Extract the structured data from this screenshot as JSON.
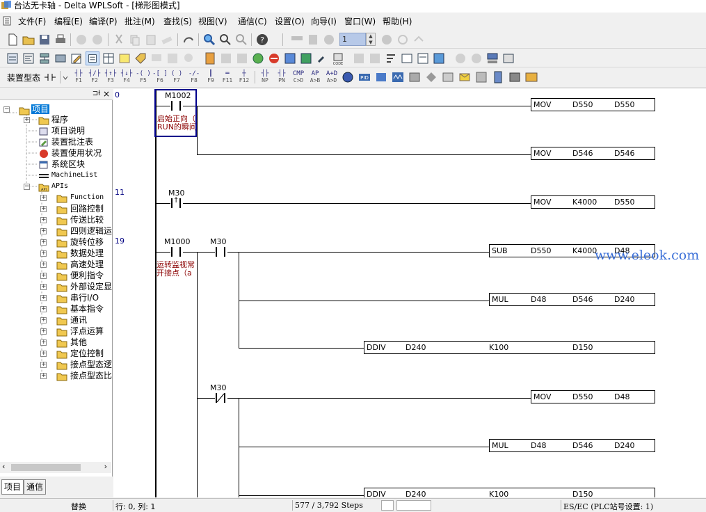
{
  "window": {
    "title": "台达无卡轴 - Delta WPLSoft - [梯形图模式]"
  },
  "menu": [
    "文件(F)",
    "编程(E)",
    "编译(P)",
    "批注(M)",
    "查找(S)",
    "视图(V)",
    "通信(C)",
    "设置(O)",
    "向导(I)",
    "窗口(W)",
    "帮助(H)"
  ],
  "toolbar": {
    "step_value": "1"
  },
  "devbar": {
    "label": "装置型态",
    "fkeys": [
      {
        "sym": "┤├",
        "lbl": "F1"
      },
      {
        "sym": "┤/├",
        "lbl": "F2"
      },
      {
        "sym": "┤↑├",
        "lbl": "F3"
      },
      {
        "sym": "┤↓├",
        "lbl": "F4"
      },
      {
        "sym": "-( )",
        "lbl": "F5"
      },
      {
        "sym": "-[ ]",
        "lbl": "F6"
      },
      {
        "sym": "( )",
        "lbl": "F7"
      },
      {
        "sym": "-/-",
        "lbl": "F8"
      },
      {
        "sym": "┃",
        "lbl": "F9"
      },
      {
        "sym": "═",
        "lbl": "F11"
      },
      {
        "sym": "┼",
        "lbl": "F12"
      },
      {
        "sym": "┤├",
        "lbl": "NP"
      },
      {
        "sym": "┤├",
        "lbl": "PN"
      },
      {
        "sym": "CMP",
        "lbl": "C>D"
      },
      {
        "sym": "AP",
        "lbl": "A>B"
      },
      {
        "sym": "A+D",
        "lbl": "A>D"
      }
    ]
  },
  "tree": {
    "root": "项目",
    "items": [
      "程序",
      "项目说明",
      "装置批注表",
      "装置使用状况",
      "系统区块",
      "MachineList"
    ],
    "apis_label": "APIs",
    "apis": [
      "Function",
      "回路控制",
      "传送比较",
      "四则逻辑运",
      "旋转位移",
      "数据处理",
      "高速处理",
      "便利指令",
      "外部设定显",
      "串行I/O",
      "基本指令",
      "通讯",
      "浮点运算",
      "其他",
      "定位控制",
      "接点型态逻",
      "接点型态比"
    ]
  },
  "panel_tabs": [
    "项目",
    "通信"
  ],
  "ladder": {
    "steps": [
      "0",
      "11",
      "19"
    ],
    "contacts": [
      {
        "label": "M1002",
        "comment1": "启始正向（",
        "comment2": "RUN的瞬间"
      },
      {
        "label": "M30"
      },
      {
        "label": "M1000",
        "comment1": "运转监视常",
        "comment2": "开接点（a"
      },
      {
        "label": "M30"
      },
      {
        "label": "M30"
      }
    ],
    "instructions": [
      {
        "op": "MOV",
        "a": "D550",
        "b": "D550"
      },
      {
        "op": "MOV",
        "a": "D546",
        "b": "D546"
      },
      {
        "op": "MOV",
        "a": "K4000",
        "b": "D550"
      },
      {
        "op": "SUB",
        "a": "D550",
        "b": "K4000",
        "c": "D48"
      },
      {
        "op": "MUL",
        "a": "D48",
        "b": "D546",
        "c": "D240"
      },
      {
        "op": "DDIV",
        "a": "D240",
        "b": "K100",
        "c": "D150"
      },
      {
        "op": "MOV",
        "a": "D550",
        "b": "D48"
      },
      {
        "op": "MUL",
        "a": "D48",
        "b": "D546",
        "c": "D240"
      },
      {
        "op": "DDIV",
        "a": "D240",
        "b": "K100",
        "c": "D150"
      }
    ]
  },
  "watermark": "www.eleok.com",
  "status": {
    "mode": "替换",
    "position": "行: 0, 列: 1",
    "steps": "577 / 3,792 Steps",
    "plc": "ES/EC (PLC站号设置: 1)"
  }
}
